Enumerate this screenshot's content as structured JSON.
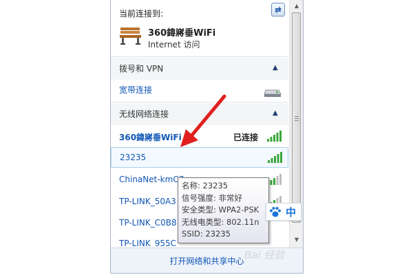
{
  "current": {
    "header": "当前连接到:",
    "network_name": "360鍏嶈垂WiFi",
    "access": "Internet 访问"
  },
  "dialup_group": {
    "title": "拨号和 VPN",
    "items": [
      {
        "label": "宽带连接"
      }
    ]
  },
  "wireless_group": {
    "title": "无线网络连接",
    "networks": [
      {
        "name": "360鍏嶈垂WiFi",
        "status": "已连接"
      },
      {
        "name": "23235"
      },
      {
        "name": "ChinaNet-kmC7"
      },
      {
        "name": "TP-LINK_50A3"
      },
      {
        "name": "TP-LINK_C0B8"
      },
      {
        "name": "TP-LINK_955C"
      }
    ]
  },
  "tooltip": {
    "lines": [
      "名称: 23235",
      "信号强度: 非常好",
      "安全类型: WPA2-PSK",
      "无线电类型: 802.11n",
      "SSID: 23235"
    ]
  },
  "footer": {
    "link": "打开网络和共享中心"
  },
  "ime": {
    "mode": "中"
  },
  "watermark": "Bai 经验",
  "colors": {
    "link": "#0f56b4",
    "signal": "#3aa63a",
    "arrow": "#e02020"
  }
}
